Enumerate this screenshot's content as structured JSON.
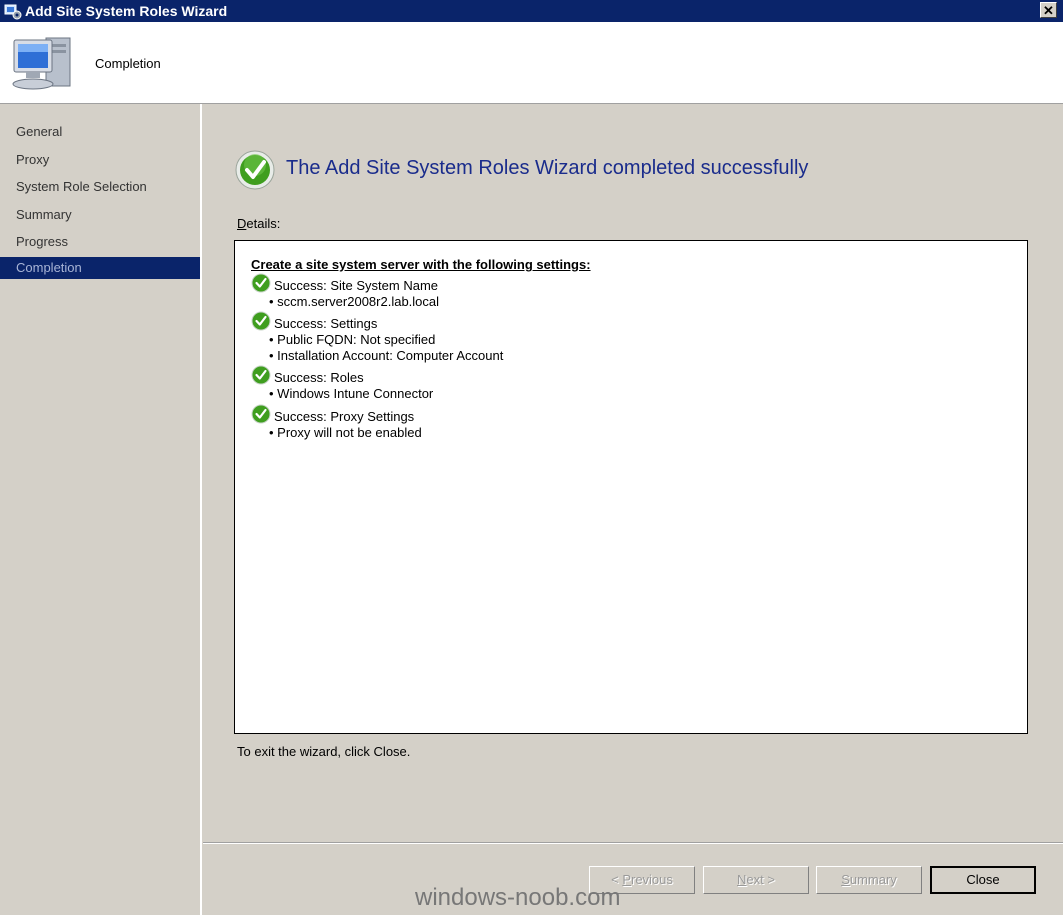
{
  "window": {
    "title": "Add Site System Roles Wizard",
    "close_label": "✕"
  },
  "header": {
    "title": "Completion",
    "icon": "computer-icon"
  },
  "sidebar": {
    "items": [
      {
        "label": "General",
        "active": false
      },
      {
        "label": "Proxy",
        "active": false
      },
      {
        "label": "System Role Selection",
        "active": false
      },
      {
        "label": "Summary",
        "active": false
      },
      {
        "label": "Progress",
        "active": false
      },
      {
        "label": "Completion",
        "active": true
      }
    ]
  },
  "main": {
    "heading": "The Add Site System Roles Wizard completed successfully",
    "details_label_access": "D",
    "details_label_rest": "etails:",
    "details_header": "Create a site system server with the following settings:",
    "results": [
      {
        "title": "Success: Site System Name",
        "bullets": [
          "sccm.server2008r2.lab.local"
        ]
      },
      {
        "title": "Success: Settings",
        "bullets": [
          "Public FQDN: Not specified",
          "Installation Account: Computer Account"
        ]
      },
      {
        "title": "Success: Roles",
        "bullets": [
          "Windows Intune Connector"
        ]
      },
      {
        "title": "Success: Proxy Settings",
        "bullets": [
          "Proxy will not be enabled"
        ]
      }
    ],
    "exit_text": "To exit the wizard, click Close."
  },
  "buttons": {
    "previous_pre": "< ",
    "previous_key": "P",
    "previous_post": "revious",
    "next_key": "N",
    "next_post": "ext >",
    "summary_key": "S",
    "summary_post": "ummary",
    "close": "Close"
  },
  "watermark": "windows-noob.com",
  "colors": {
    "title_bar": "#0a246a",
    "heading": "#1a2c8c",
    "dialog_bg": "#d4d0c8",
    "success_green": "#3f9e1f"
  }
}
